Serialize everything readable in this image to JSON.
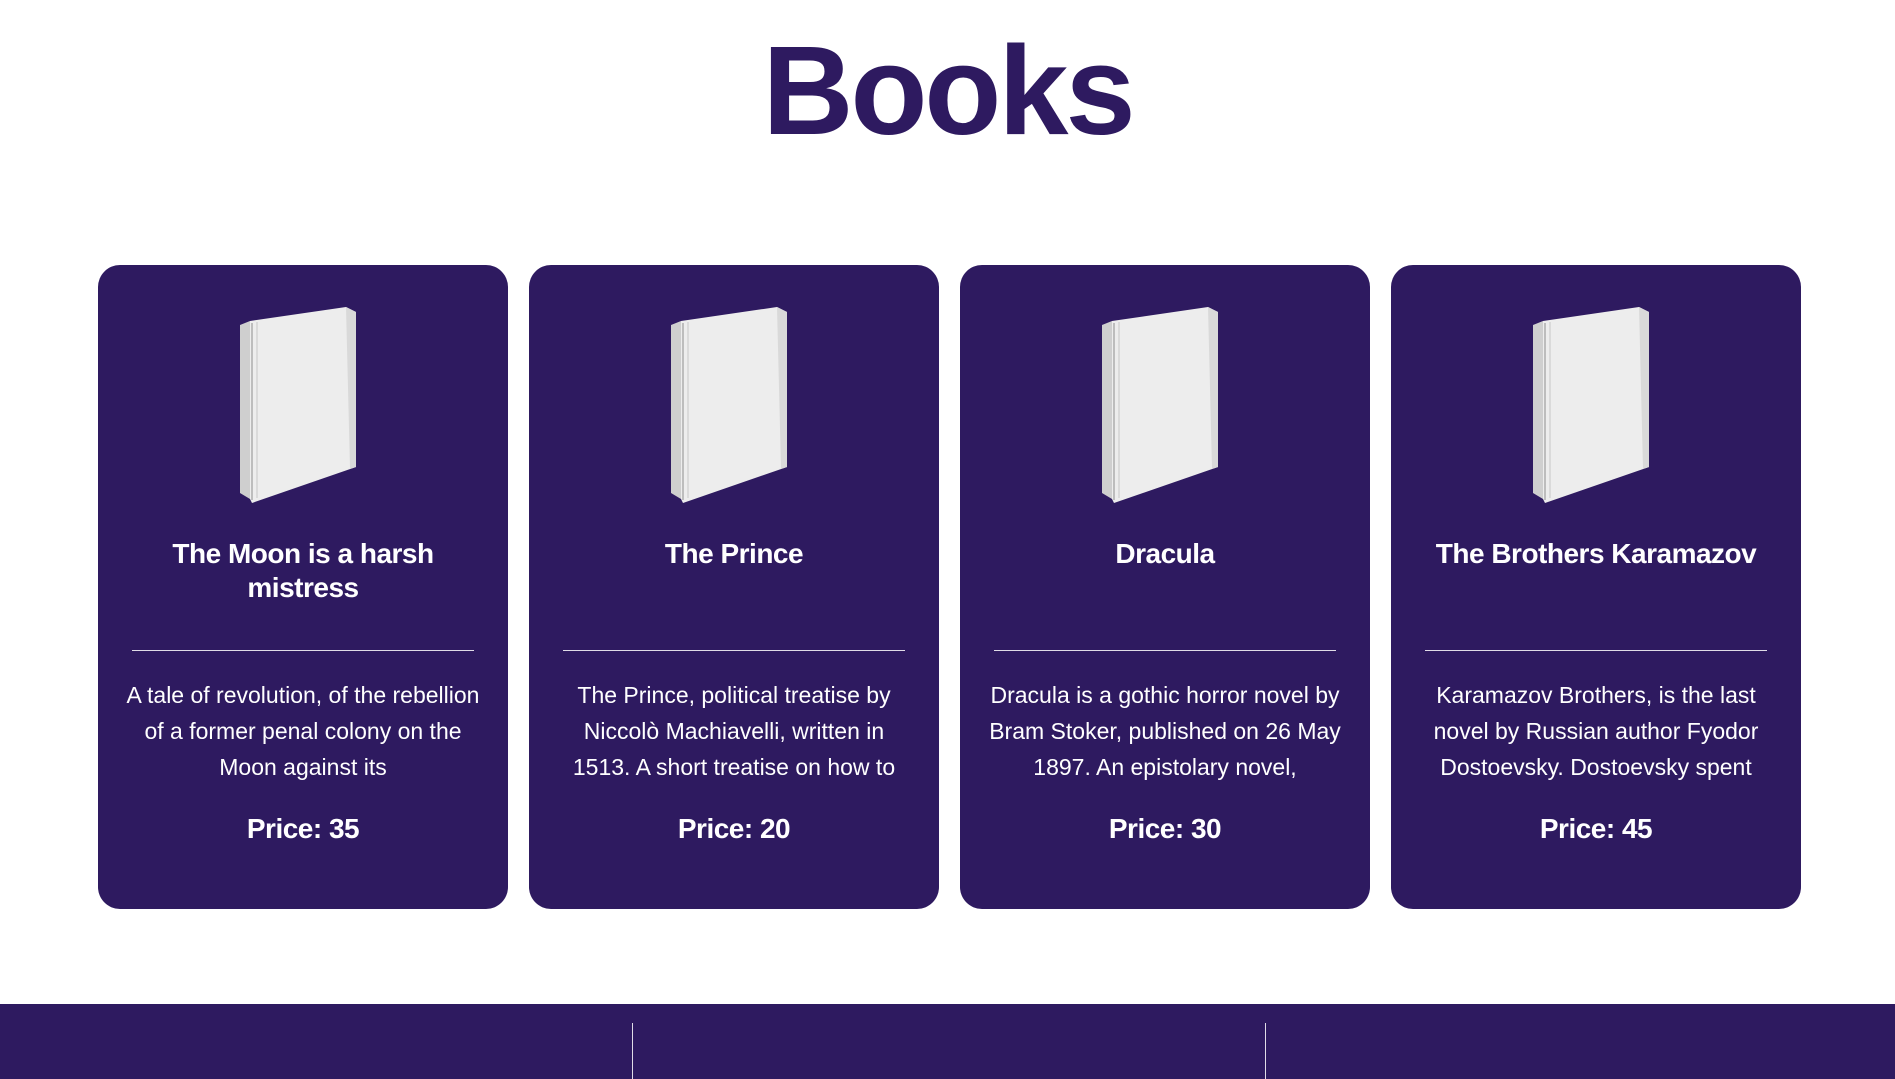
{
  "page": {
    "title": "Books"
  },
  "books": [
    {
      "title": "The Moon is a harsh mistress",
      "description": "A tale of revolution, of the rebellion of a former penal colony on the Moon against its",
      "price": "Price: 35",
      "image_icon": "book-icon"
    },
    {
      "title": "The Prince",
      "description": "The Prince, political treatise by Niccolò Machiavelli, written in 1513. A short treatise on how to",
      "price": "Price: 20",
      "image_icon": "book-icon"
    },
    {
      "title": "Dracula",
      "description": "Dracula is a gothic horror novel by Bram Stoker, published on 26 May 1897. An epistolary novel,",
      "price": "Price: 30",
      "image_icon": "book-icon"
    },
    {
      "title": "The Brothers Karamazov",
      "description": "Karamazov Brothers, is the last novel by Russian author Fyodor Dostoevsky. Dostoevsky spent",
      "price": "Price: 45",
      "image_icon": "book-icon"
    }
  ],
  "colors": {
    "brand": "#2e1a60",
    "card_text": "#ffffff",
    "background": "#ffffff"
  }
}
